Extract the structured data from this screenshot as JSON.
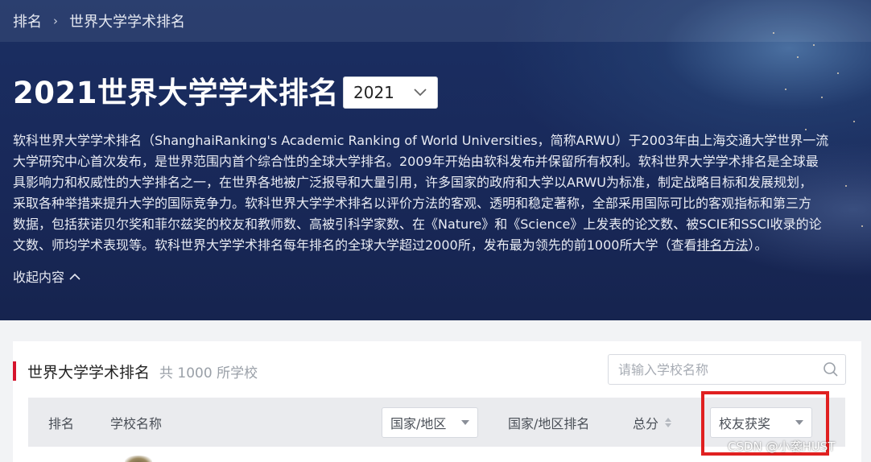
{
  "breadcrumb": {
    "root": "排名",
    "separator": "›",
    "current": "世界大学学术排名"
  },
  "header": {
    "title": "2021世界大学学术排名",
    "year_selected": "2021"
  },
  "intro": {
    "line1": "软科世界大学学术排名（ShanghaiRanking's Academic Ranking of World Universities，简称ARWU）于2003年由上海交通大学世界一流",
    "line2": "大学研究中心首次发布，是世界范围内首个综合性的全球大学排名。2009年开始由软科发布并保留所有权利。软科世界大学学术排名是全球最",
    "line3": "具影响力和权威性的大学排名之一，在世界各地被广泛报导和大量引用，许多国家的政府和大学以ARWU为标准，制定战略目标和发展规划，",
    "line4": "采取各种举措来提升大学的国际竞争力。软科世界大学学术排名以评价方法的客观、透明和稳定著称，全部采用国际可比的客观指标和第三方",
    "line5": "数据，包括获诺贝尔奖和菲尔兹奖的校友和教师数、高被引科学家数、在《Nature》和《Science》上发表的论文数、被SCIE和SSCI收录的论",
    "line6_before": "文数、师均学术表现等。软科世界大学学术排名每年排名的全球大学超过2000所，发布最为领先的前1000所大学（查看",
    "line6_link": "排名方法",
    "line6_after": "）。"
  },
  "collapse_label": "收起内容",
  "panel": {
    "title": "世界大学学术排名",
    "count_text": "共 1000 所学校",
    "search_placeholder": "请输入学校名称"
  },
  "table_header": {
    "rank": "排名",
    "school": "学校名称",
    "country_filter": "国家/地区",
    "country_rank": "国家/地区排名",
    "total_score": "总分",
    "indicator_select": "校友获奖"
  },
  "watermark": "CSDN @小袭HUST",
  "colors": {
    "accent_red": "#d6132c",
    "highlight_red": "#e02020",
    "hero_bg": "#1a2f63"
  }
}
